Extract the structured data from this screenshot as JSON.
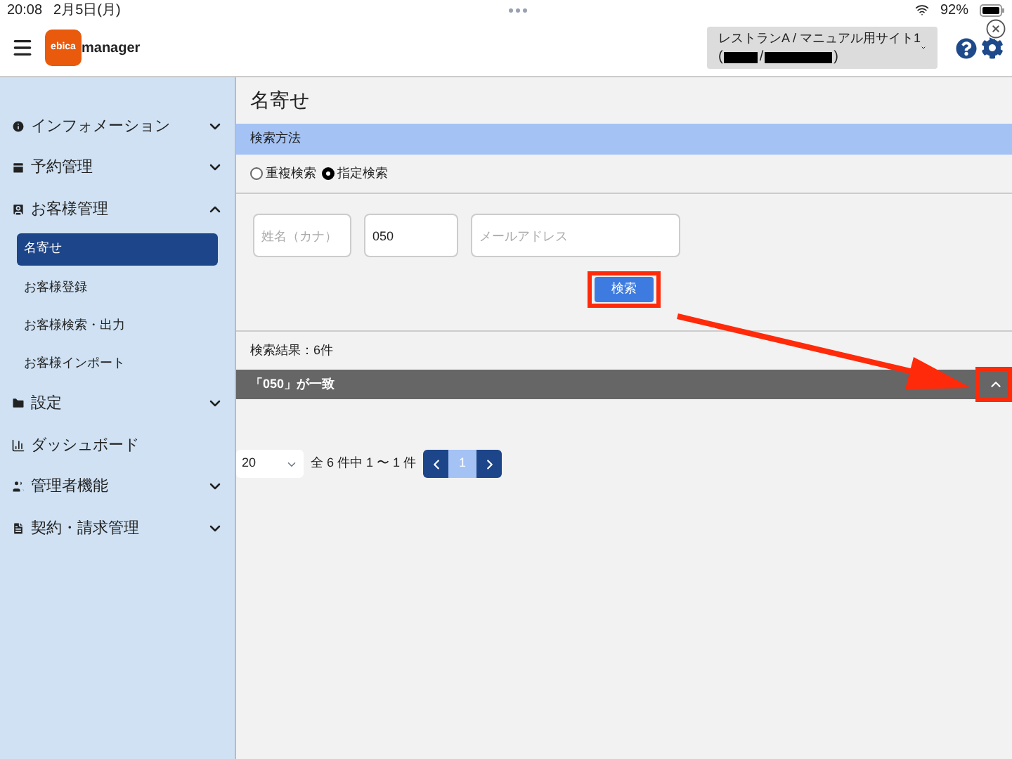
{
  "status_bar": {
    "time": "20:08",
    "date": "2月5日(月)",
    "battery": "92%"
  },
  "header": {
    "logo": "ebica",
    "app_name": "manager",
    "site": {
      "name": "レストランA / マニュアル用サイト1",
      "account_parts": [
        "(",
        "/",
        ")"
      ]
    }
  },
  "sidebar": {
    "items": [
      {
        "label": "インフォメーション",
        "expanded": false
      },
      {
        "label": "予約管理",
        "expanded": false
      },
      {
        "label": "お客様管理",
        "expanded": true,
        "children": [
          {
            "label": "名寄せ",
            "selected": true
          },
          {
            "label": "お客様登録",
            "selected": false
          },
          {
            "label": "お客様検索・出力",
            "selected": false
          },
          {
            "label": "お客様インポート",
            "selected": false
          }
        ]
      },
      {
        "label": "設定",
        "expanded": false
      },
      {
        "label": "ダッシュボード"
      },
      {
        "label": "管理者機能",
        "expanded": false
      },
      {
        "label": "契約・請求管理",
        "expanded": false
      }
    ]
  },
  "page": {
    "title": "名寄せ",
    "section": "検索方法",
    "methods": [
      {
        "label": "重複検索",
        "selected": false
      },
      {
        "label": "指定検索",
        "selected": true
      }
    ],
    "fields": [
      {
        "placeholder": "姓名（カナ）"
      },
      {
        "value": "050"
      },
      {
        "placeholder": "メールアドレス"
      }
    ],
    "search_button": "検索",
    "result_count": "検索結果：6件",
    "group": {
      "label": "「050」が一致",
      "expanded": true
    },
    "pagination": {
      "page_size": "20",
      "summary": "全 6 件中 1 〜 1 件",
      "pages": [
        {
          "label": "1",
          "selected": true
        }
      ]
    }
  }
}
